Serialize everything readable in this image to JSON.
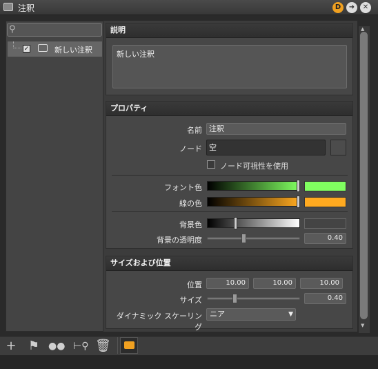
{
  "window": {
    "title": "注釈",
    "btn_d": "D"
  },
  "tree": {
    "item_label": "新しい注釈",
    "item_checked": true
  },
  "description": {
    "header": "説明",
    "text": "新しい注釈"
  },
  "properties": {
    "header": "プロパティ",
    "name_label": "名前",
    "name_value": "注釈",
    "node_label": "ノード",
    "node_value": "空",
    "node_visibility_label": "ノード可視性を使用",
    "node_visibility_checked": false,
    "font_color_label": "フォント色",
    "font_color": "#80ff60",
    "line_color_label": "線の色",
    "line_color": "#ffaa20",
    "bg_color_label": "背景色",
    "bg_color": "#444444",
    "bg_opacity_label": "背景の透明度",
    "bg_opacity": "0.40"
  },
  "size_position": {
    "header": "サイズおよび位置",
    "position_label": "位置",
    "pos_x": "10.00",
    "pos_y": "10.00",
    "pos_z": "10.00",
    "size_label": "サイズ",
    "size_value": "0.40",
    "dynamic_scaling_label": "ダイナミック スケーリング",
    "dynamic_scaling_value": "ニア"
  },
  "toolbar": {
    "icons": [
      "plus-icon",
      "flag-icon",
      "circles-icon",
      "search-node-icon",
      "trash-icon",
      "annotation-icon"
    ],
    "active_color": "#f0a020"
  }
}
